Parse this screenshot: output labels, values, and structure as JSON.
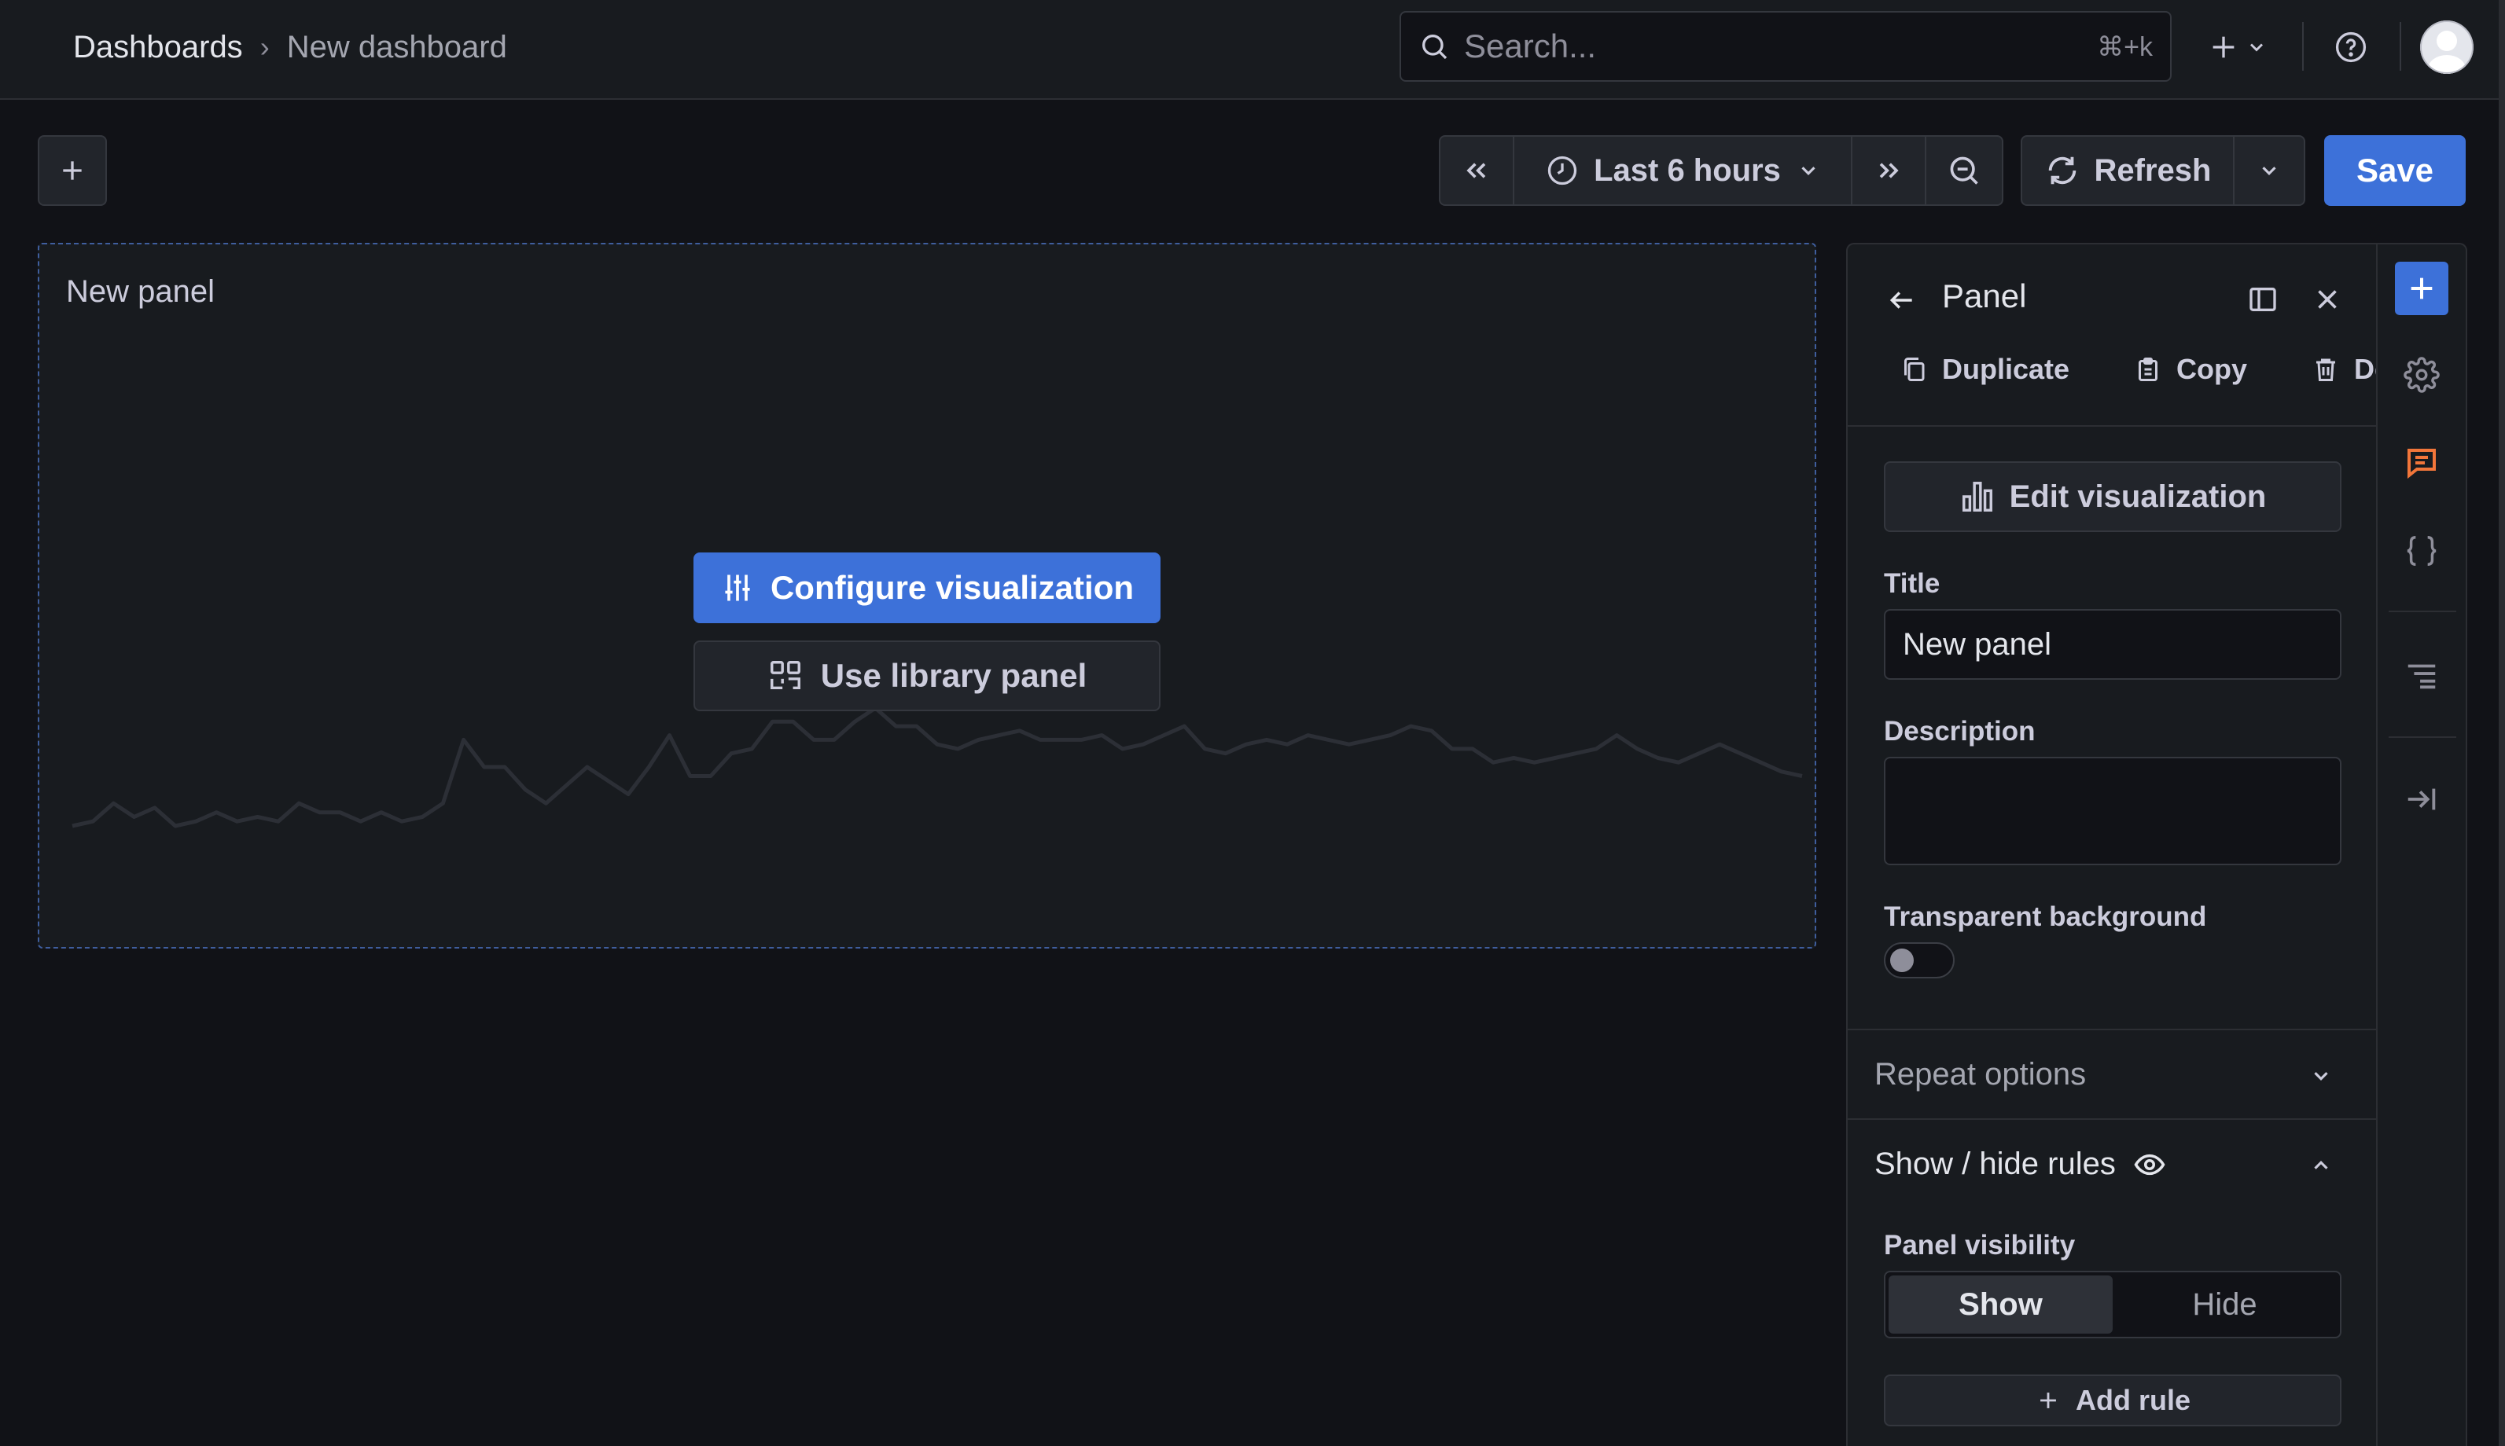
{
  "topbar": {
    "breadcrumb": {
      "root": "Dashboards",
      "separator": "›",
      "current": "New dashboard"
    },
    "search": {
      "placeholder": "Search...",
      "shortcut": "⌘+k"
    }
  },
  "toolbar": {
    "time_range_label": "Last 6 hours",
    "refresh_label": "Refresh",
    "save_label": "Save"
  },
  "panel": {
    "title": "New panel",
    "configure_label": "Configure visualization",
    "library_label": "Use library panel",
    "sparkline": [
      45,
      44,
      40,
      43,
      41,
      45,
      44,
      42,
      44,
      43,
      44,
      40,
      42,
      42,
      44,
      42,
      44,
      43,
      40,
      26,
      32,
      32,
      37,
      40,
      36,
      32,
      35,
      38,
      32,
      25,
      34,
      34,
      29,
      28,
      22,
      22,
      26,
      26,
      22,
      19,
      23,
      23,
      27,
      28,
      26,
      25,
      24,
      26,
      26,
      26,
      25,
      28,
      27,
      25,
      23,
      28,
      29,
      27,
      26,
      27,
      25,
      26,
      27,
      26,
      25,
      23,
      24,
      28,
      28,
      31,
      30,
      31,
      30,
      29,
      28,
      25,
      28,
      30,
      31,
      29,
      27,
      29,
      31,
      33,
      34
    ]
  },
  "pane": {
    "header": "Panel",
    "actions": {
      "duplicate": "Duplicate",
      "copy": "Copy",
      "delete": "De"
    },
    "edit_visualization": "Edit visualization",
    "title_label": "Title",
    "title_value": "New panel",
    "description_label": "Description",
    "description_value": "",
    "transparent_label": "Transparent background",
    "transparent_on": false,
    "repeat_options": "Repeat options",
    "show_hide_rules": "Show / hide rules",
    "panel_visibility_label": "Panel visibility",
    "visibility": {
      "show": "Show",
      "hide": "Hide",
      "selected": "Show"
    },
    "add_rule": "Add rule"
  },
  "colors": {
    "accent": "#3d71d9",
    "comment_icon": "#f2763a",
    "background": "#111217",
    "surface": "#181b1f"
  }
}
